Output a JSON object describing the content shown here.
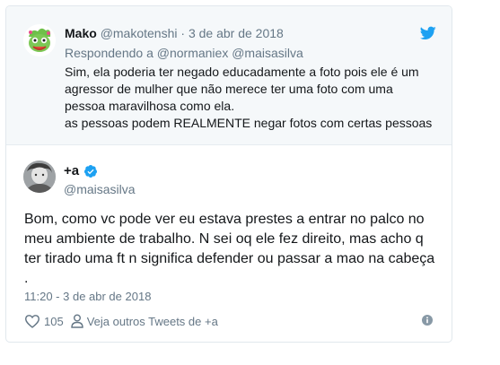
{
  "parent_tweet": {
    "author_name": "Mako",
    "author_handle": "@makotenshi",
    "separator": "·",
    "date": "3 de abr de 2018",
    "replying_to": "Respondendo a @normaniex @maisasilva",
    "text_lines": [
      "Sim, ela poderia ter negado educadamente a foto pois ele é um",
      "agressor de mulher que não merece ter uma foto com uma",
      "pessoa maravilhosa como ela.",
      "as pessoas podem REALMENTE negar fotos com certas pessoas"
    ],
    "brand_icon": "twitter-bird-icon"
  },
  "main_tweet": {
    "author_name": "+a",
    "verified": true,
    "author_handle": "@maisasilva",
    "text_lines": [
      "Bom, como vc pode ver eu estava prestes a entrar no palco no",
      "meu ambiente de trabalho. N sei oq ele fez direito, mas acho q",
      "ter tirado uma ft n significa defender ou passar a mao na cabeça",
      "."
    ],
    "timestamp": "11:20 - 3 de abr de 2018",
    "like_count": "105",
    "others_label": "Veja outros Tweets de +a"
  },
  "colors": {
    "twitter_blue": "#1da1f2",
    "muted_text": "#657786",
    "primary_text": "#14171a",
    "parent_background": "#f5f8fa",
    "border": "#e1e8ed"
  }
}
